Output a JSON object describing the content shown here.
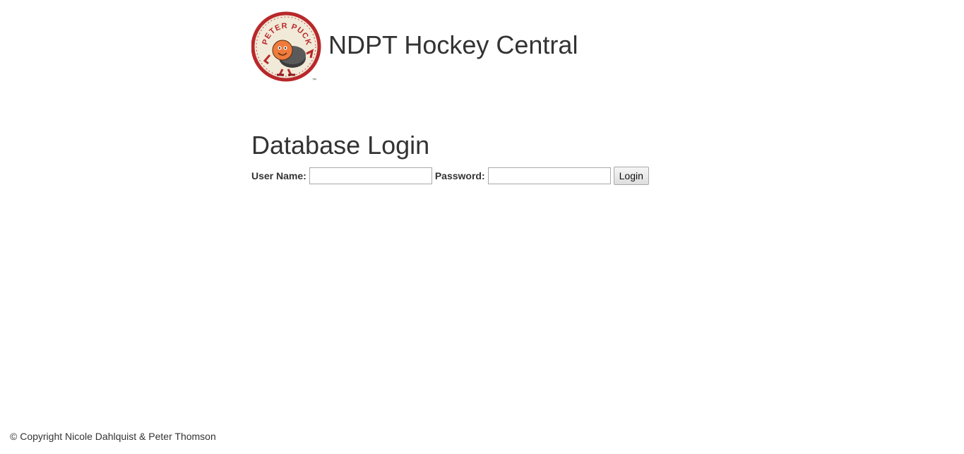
{
  "header": {
    "logo_text": "PETER PUCK",
    "logo_trademark": "™",
    "title": "NDPT Hockey Central"
  },
  "login": {
    "heading": "Database Login",
    "username_label": "User Name:",
    "username_value": "",
    "password_label": "Password:",
    "password_value": "",
    "submit_label": "Login"
  },
  "footer": {
    "copyright": "© Copyright Nicole Dahlquist & Peter Thomson"
  },
  "colors": {
    "text": "#333333",
    "logo_ring": "#b8282b",
    "logo_face": "#ef7b3b",
    "logo_background": "#f1ead8"
  }
}
